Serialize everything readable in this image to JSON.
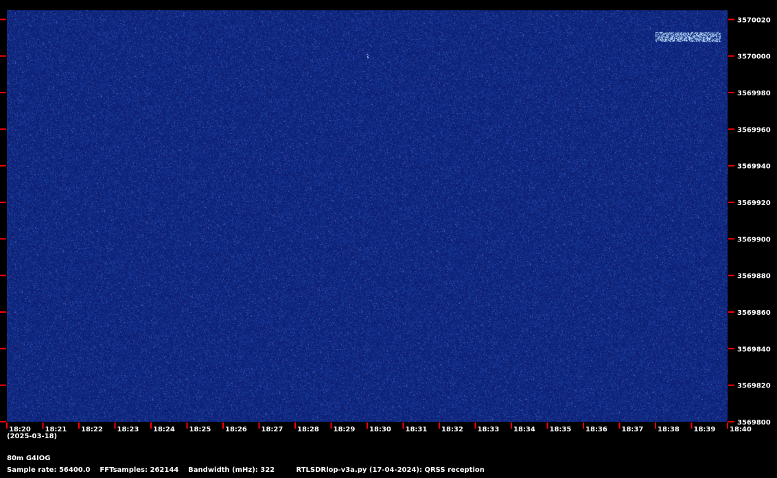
{
  "chart_data": {
    "type": "heatmap",
    "title": "",
    "xlabel": "",
    "ylabel": "",
    "x_ticks": [
      "18:20",
      "18:21",
      "18:22",
      "18:23",
      "18:24",
      "18:25",
      "18:26",
      "18:27",
      "18:28",
      "18:29",
      "18:30",
      "18:31",
      "18:32",
      "18:33",
      "18:34",
      "18:35",
      "18:36",
      "18:37",
      "18:38",
      "18:39",
      "18:40"
    ],
    "y_ticks": [
      3570020,
      3570000,
      3569980,
      3569960,
      3569940,
      3569920,
      3569900,
      3569880,
      3569860,
      3569840,
      3569820,
      3569800
    ],
    "ylim": [
      3569800,
      3570025
    ],
    "colors": {
      "background": "#000000",
      "noise_floor": "#0b1d55",
      "signal": "#c8e6ff",
      "tick": "#ff0000",
      "label": "#ffffff"
    },
    "signals": [
      {
        "time_start": "18:38",
        "time_end": "18:39.8",
        "freq_low": 3570008,
        "freq_high": 3570013,
        "description": "weak QRSS trace"
      },
      {
        "time_start": "18:30",
        "time_end": "18:30",
        "freq_low": 3569999,
        "freq_high": 3570001,
        "description": "single spike"
      }
    ]
  },
  "date_label": "(2025-03-18)",
  "band_label": "80m G4IOG",
  "info_line": "Sample rate: 56400.0    FFTsamples: 262144    Bandwidth (mHz): 322         RTLSDRlop-v3a.py (17-04-2024): QRSS reception"
}
